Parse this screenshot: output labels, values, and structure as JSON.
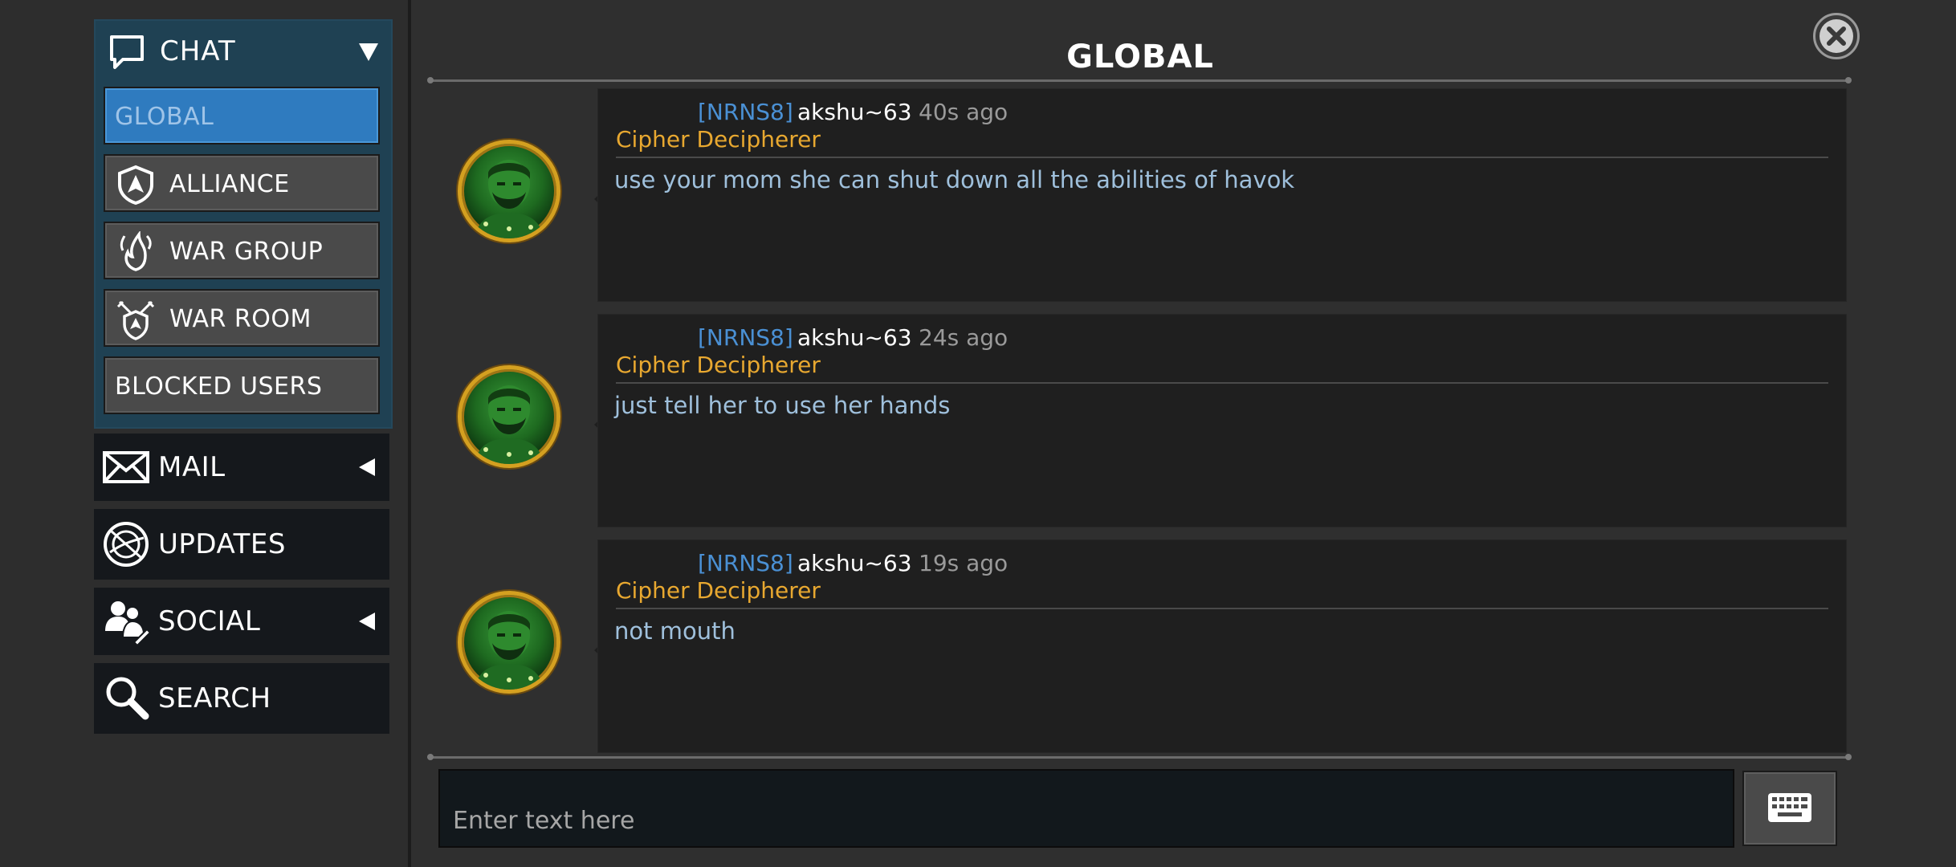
{
  "sidebar": {
    "chat": {
      "label": "CHAT",
      "icon": "chat-bubble-icon"
    },
    "channels": [
      {
        "label": "GLOBAL",
        "active": true
      },
      {
        "label": "ALLIANCE",
        "icon": "shield-icon"
      },
      {
        "label": "WAR GROUP",
        "icon": "flame-icon"
      },
      {
        "label": "WAR ROOM",
        "icon": "crossed-swords-shield-icon"
      },
      {
        "label": "BLOCKED USERS"
      }
    ],
    "nav": [
      {
        "label": "MAIL",
        "icon": "envelope-icon"
      },
      {
        "label": "UPDATES",
        "icon": "globe-icon"
      },
      {
        "label": "SOCIAL",
        "icon": "people-icon"
      },
      {
        "label": "SEARCH",
        "icon": "magnifier-icon"
      }
    ]
  },
  "header": {
    "title": "GLOBAL"
  },
  "messages": [
    {
      "tag": "[NRNS8]",
      "user": "akshu~63",
      "time": "40s ago",
      "title": "Cipher Decipherer",
      "text": "use your mom she can shut down all the abilities of havok"
    },
    {
      "tag": "[NRNS8]",
      "user": "akshu~63",
      "time": "24s ago",
      "title": "Cipher Decipherer",
      "text": "just tell her to use her hands"
    },
    {
      "tag": "[NRNS8]",
      "user": "akshu~63",
      "time": "19s ago",
      "title": "Cipher Decipherer",
      "text": "not mouth"
    }
  ],
  "input": {
    "placeholder": "Enter text here"
  },
  "colors": {
    "active_channel": "#2f7bbf",
    "alliance_tag": "#4a90d4",
    "player_title": "#e8a830",
    "message_text": "#9fc0dc"
  }
}
